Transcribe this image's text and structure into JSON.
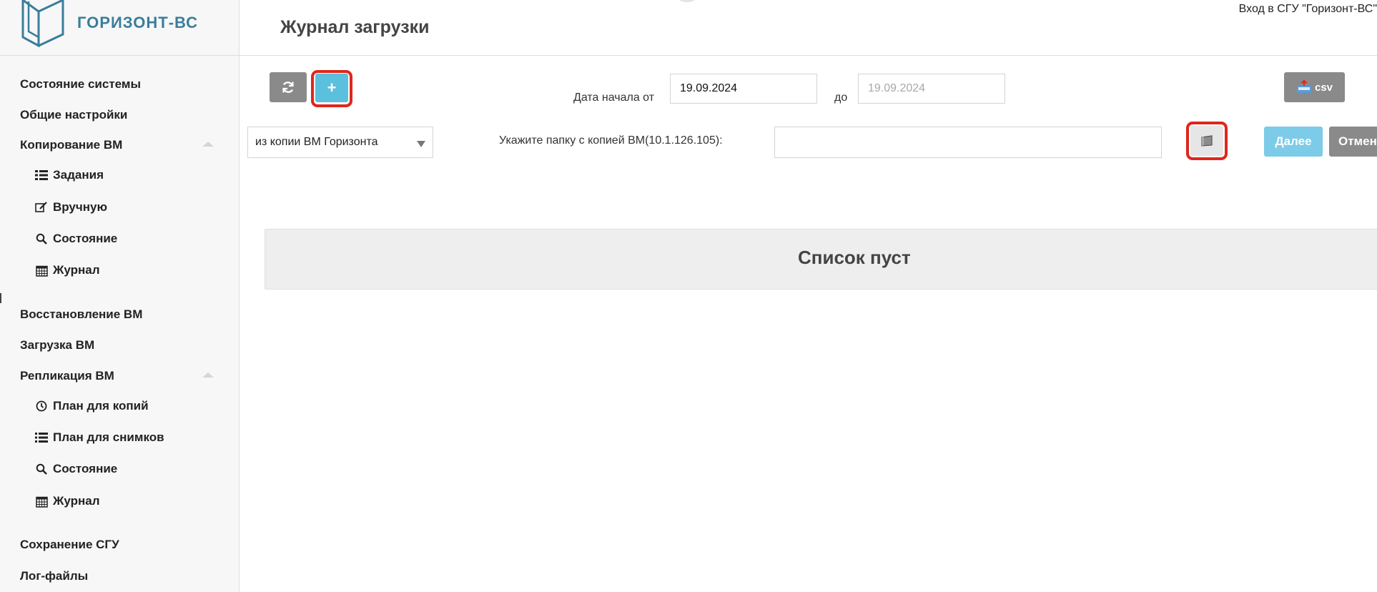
{
  "logo": {
    "text": "ГОРИЗОНТ-ВС",
    "color": "#3a7d9c"
  },
  "header": {
    "title": "Журнал загрузки",
    "login": "Вход в СГУ \"Горизонт-ВС\""
  },
  "sidebar": {
    "items": [
      {
        "label": "Состояние системы"
      },
      {
        "label": "Общие настройки"
      },
      {
        "label": "Копирование ВМ",
        "expanded": true
      },
      {
        "label": "Задания",
        "icon": "list-icon",
        "sub": true
      },
      {
        "label": "Вручную",
        "icon": "edit-icon",
        "sub": true
      },
      {
        "label": "Состояние",
        "icon": "search-icon",
        "sub": true
      },
      {
        "label": "Журнал",
        "icon": "calendar-icon",
        "sub": true
      },
      {
        "label": "Восстановление ВМ"
      },
      {
        "label": "Загрузка ВМ"
      },
      {
        "label": "Репликация ВМ",
        "expanded": true
      },
      {
        "label": "План для копий",
        "icon": "clock-icon",
        "sub": true
      },
      {
        "label": "План для снимков",
        "icon": "list-icon",
        "sub": true
      },
      {
        "label": "Состояние",
        "icon": "search-icon",
        "sub": true
      },
      {
        "label": "Журнал",
        "icon": "calendar-icon",
        "sub": true
      },
      {
        "label": "Сохранение СГУ"
      },
      {
        "label": "Лог-файлы"
      }
    ]
  },
  "toolbar": {
    "refresh_icon": "refresh-icon",
    "add_label": "+",
    "date_from_label": "Дата начала от",
    "date_from_value": "19.09.2024",
    "date_to_label": "до",
    "date_to_value": "19.09.2024",
    "csv_label": "csv"
  },
  "source": {
    "select_value": "из копии ВМ Горизонта",
    "folder_label": "Укажите папку с копией ВМ(10.1.126.105):",
    "folder_value": "",
    "next_label": "Далее",
    "cancel_label": "Отмен"
  },
  "main": {
    "empty_text": "Список пуст"
  },
  "colors": {
    "accent_blue": "#5bc0de",
    "gray_button": "#8a8a8a",
    "highlight": "#e0261c"
  }
}
